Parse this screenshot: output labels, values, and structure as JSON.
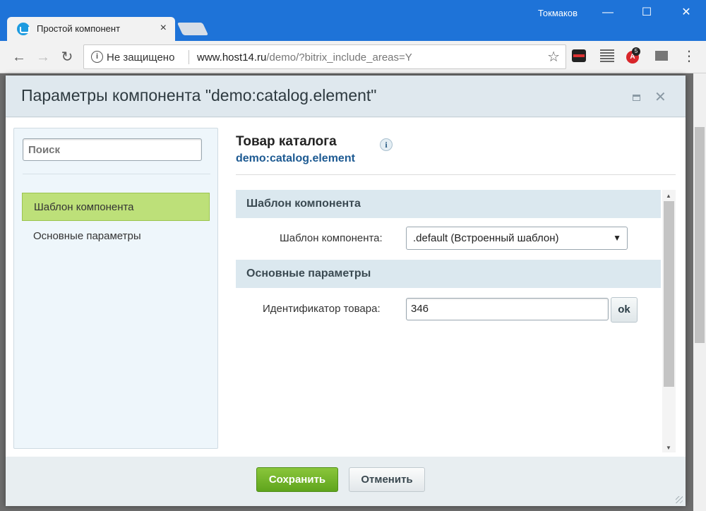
{
  "browser": {
    "tab_title": "Простой компонент",
    "tab_close": "×",
    "user_name": "Токмаков",
    "window_controls": {
      "minimize": "—",
      "maximize": "☐",
      "close": "✕"
    },
    "nav": {
      "back": "←",
      "forward": "→",
      "reload": "↻"
    },
    "security_text": "Не защищено",
    "url_host": "www.host14.ru",
    "url_path": "/demo/?bitrix_include_areas=Y",
    "bookmark_star": "☆",
    "menu": "⋮",
    "extension_abp_badge": "5"
  },
  "dialog": {
    "title": "Параметры компонента \"demo:catalog.element\"",
    "close": "✕",
    "search": {
      "placeholder": "Поиск"
    },
    "nav_items": [
      {
        "label": "Шаблон компонента",
        "active": true
      },
      {
        "label": "Основные параметры",
        "active": false
      }
    ],
    "content": {
      "title": "Товар каталога",
      "subtitle": "demo:catalog.element",
      "info": "i",
      "sections": [
        {
          "title": "Шаблон компонента",
          "field_label": "Шаблон компонента:",
          "field_value": ".default (Встроенный шаблон)",
          "arrow": "▼"
        },
        {
          "title": "Основные параметры",
          "field_label": "Идентификатор товара:",
          "field_value": "346",
          "button": "ok"
        }
      ],
      "scroll_up": "▲",
      "scroll_down": "▼"
    },
    "footer": {
      "save": "Сохранить",
      "cancel": "Отменить"
    }
  },
  "colors": {
    "titlebar": "#1e73d8",
    "active_nav": "#bde079",
    "save_button": "#6fb32a",
    "section_header": "#dbe8ef",
    "subtitle_link": "#1d5a92"
  }
}
